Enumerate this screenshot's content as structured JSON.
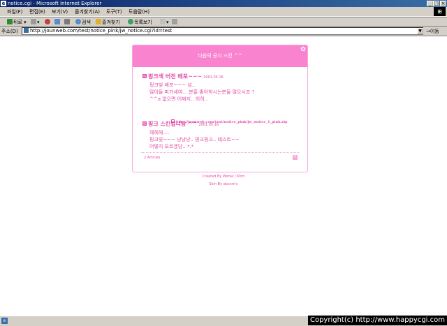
{
  "window": {
    "title": "notice.cgi - Microsoft Internet Explorer",
    "icon": "ie-icon"
  },
  "menu": [
    "파일(F)",
    "편집(E)",
    "보기(V)",
    "즐겨찾기(A)",
    "도구(T)",
    "도움말(H)"
  ],
  "toolbar": {
    "back": "뒤로",
    "search": "검색",
    "favorites": "즐겨찾기",
    "history": "목록보기"
  },
  "address": {
    "label": "주소(D)",
    "url": "http://jounweb.com/test/notice_pink/jw_notice.cgi?id=test",
    "go": "이동"
  },
  "notice": {
    "header": "다음의 공지 스킨 ^^",
    "posts": [
      {
        "title": "핑크색 버전 배포~~~",
        "date": "2001.05.16",
        "lines": [
          "핑크빛 배포~~~ 넘..",
          "많이들 퍼가세여... 분홍 좋아하시는분들 많으시죠 ?",
          "^^a 없으면 어쩌지.. 히히.."
        ],
        "link": "http://jounweb.com/test/notice_pink/jw_notice_1_pink.zip"
      },
      {
        "title": "핑크 스킨입니당 ^^",
        "date": "2001.05.16",
        "lines": [
          "헤헤헤....",
          "핑크빛~~~ 냥냥냥.. 핑크핑크.. 테스트~~",
          "어떻지 모르겠당.. *.*"
        ]
      }
    ],
    "count": "2 Articles"
  },
  "credits": {
    "created": "Created By Wonie / Khm",
    "skin": "Skin By dacom's"
  },
  "copyright": "Copyright(c) http://www.happycgi.com"
}
